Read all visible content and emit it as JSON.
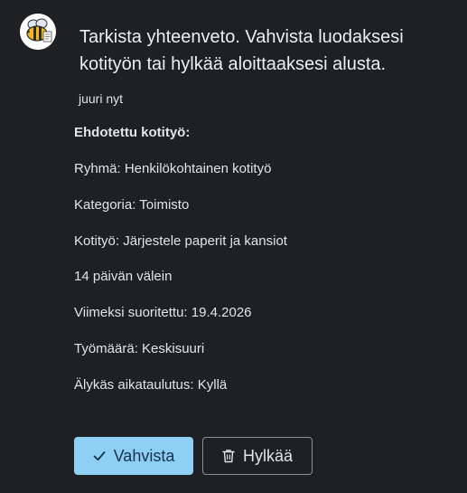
{
  "message": {
    "text": "Tarkista yhteenveto. Vahvista luodaksesi kotityön tai hylkää aloittaaksesi alusta.",
    "timestamp": "juuri nyt"
  },
  "details": {
    "heading": "Ehdotettu kotityö:",
    "rows": [
      "Ryhmä: Henkilökohtainen kotityö",
      "Kategoria: Toimisto",
      "Kotityö: Järjestele paperit ja kansiot",
      "14 päivän välein",
      "Viimeksi suoritettu: 19.4.2026",
      "Työmäärä: Keskisuuri",
      "Älykäs aikataulutus: Kyllä"
    ]
  },
  "actions": {
    "confirm_label": "Vahvista",
    "reject_label": "Hylkää"
  },
  "icons": {
    "avatar": "bee-avatar-icon",
    "confirm": "check-icon",
    "reject": "trash-icon"
  },
  "colors": {
    "background": "#1f2023",
    "confirm_button": "#8ecff6",
    "text": "#e3e4e6"
  }
}
